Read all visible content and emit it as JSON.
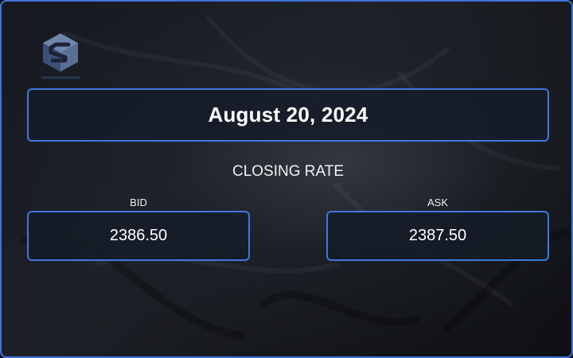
{
  "brand": {
    "logo_icon": "s-cube-logo-icon"
  },
  "rate_card": {
    "date": "August 20, 2024",
    "section_title": "CLOSING RATE",
    "bid": {
      "label": "BID",
      "value": "2386.50"
    },
    "ask": {
      "label": "ASK",
      "value": "2387.50"
    }
  },
  "colors": {
    "accent_border": "#3f78e0",
    "background": "#16191f",
    "box_fill": "#161c28",
    "text": "#ffffff"
  }
}
